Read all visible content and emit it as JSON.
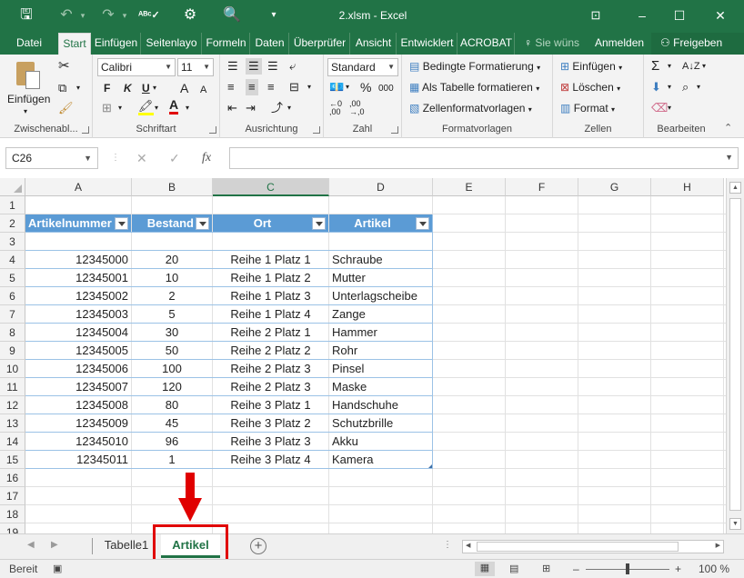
{
  "window": {
    "title": "2.xlsm - Excel",
    "minimize": "–",
    "maximize": "☐",
    "close": "✕"
  },
  "ribbon_tabs": [
    {
      "label": "Datei"
    },
    {
      "label": "Start"
    },
    {
      "label": "Einfügen"
    },
    {
      "label": "Seitenlayo"
    },
    {
      "label": "Formeln"
    },
    {
      "label": "Daten"
    },
    {
      "label": "Überprüfer"
    },
    {
      "label": "Ansicht"
    },
    {
      "label": "Entwicklert"
    },
    {
      "label": "ACROBAT"
    }
  ],
  "tell_me": "Sie wüns",
  "sign_in": "Anmelden",
  "share": "Freigeben",
  "ribbon": {
    "clipboard": {
      "paste": "Einfügen",
      "label": "Zwischenabl..."
    },
    "font": {
      "name": "Calibri",
      "size": "11",
      "bold": "F",
      "italic": "K",
      "underline": "U",
      "grow": "A",
      "shrink": "A",
      "fontcolor": "A",
      "label": "Schriftart"
    },
    "alignment": {
      "label": "Ausrichtung"
    },
    "number": {
      "format": "Standard",
      "percent": "%",
      "thousands": "000",
      "label": "Zahl"
    },
    "styles": {
      "conditional": "Bedingte Formatierung",
      "as_table": "Als Tabelle formatieren",
      "cell_styles": "Zellenformatvorlagen",
      "label": "Formatvorlagen"
    },
    "cells": {
      "insert": "Einfügen",
      "delete": "Löschen",
      "format": "Format",
      "label": "Zellen"
    },
    "editing": {
      "label": "Bearbeiten"
    }
  },
  "formula_bar": {
    "name_box": "C26",
    "fx": "fx",
    "formula": ""
  },
  "columns": [
    "A",
    "B",
    "C",
    "D",
    "E",
    "F",
    "G",
    "H"
  ],
  "rows": [
    "1",
    "2",
    "3",
    "4",
    "5",
    "6",
    "7",
    "8",
    "9",
    "10",
    "11",
    "12",
    "13",
    "14",
    "15",
    "16",
    "17",
    "18",
    "19"
  ],
  "table": {
    "headers": [
      "Artikelnummer",
      "Bestand",
      "Ort",
      "Artikel"
    ],
    "rows": [
      [
        "12345000",
        "20",
        "Reihe 1 Platz 1",
        "Schraube"
      ],
      [
        "12345001",
        "10",
        "Reihe 1 Platz 2",
        "Mutter"
      ],
      [
        "12345002",
        "2",
        "Reihe 1 Platz 3",
        "Unterlagscheibe"
      ],
      [
        "12345003",
        "5",
        "Reihe 1 Platz 4",
        "Zange"
      ],
      [
        "12345004",
        "30",
        "Reihe 2 Platz 1",
        "Hammer"
      ],
      [
        "12345005",
        "50",
        "Reihe 2 Platz 2",
        "Rohr"
      ],
      [
        "12345006",
        "100",
        "Reihe 2 Platz 3",
        "Pinsel"
      ],
      [
        "12345007",
        "120",
        "Reihe 2 Platz 3",
        "Maske"
      ],
      [
        "12345008",
        "80",
        "Reihe 3 Platz 1",
        "Handschuhe"
      ],
      [
        "12345009",
        "45",
        "Reihe 3 Platz 2",
        "Schutzbrille"
      ],
      [
        "12345010",
        "96",
        "Reihe 3 Platz 3",
        "Akku"
      ],
      [
        "12345011",
        "1",
        "Reihe 3 Platz 4",
        "Kamera"
      ]
    ]
  },
  "sheets": [
    {
      "label": "Tabelle1"
    },
    {
      "label": "Artikel"
    }
  ],
  "status": {
    "ready": "Bereit",
    "zoom": "100 %"
  },
  "colors": {
    "excel_green": "#217346",
    "table_header": "#5b9bd5",
    "annotation_red": "#e00000"
  }
}
